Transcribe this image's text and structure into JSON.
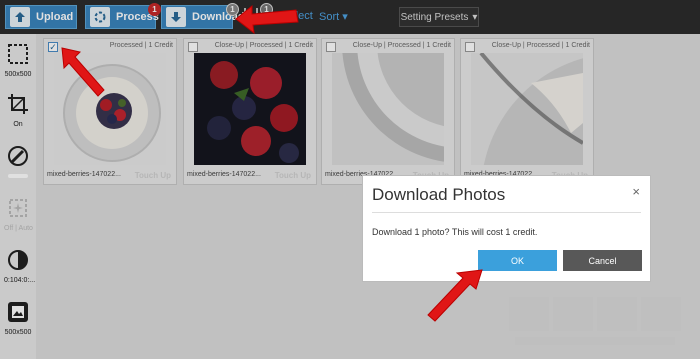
{
  "toolbar": {
    "upload_label": "Upload",
    "process_label": "Process",
    "process_badge": "1",
    "download_label": "Download",
    "download_badge": "1",
    "tray_badge": "1",
    "unselect_label": "Unselect",
    "sort_label": "Sort",
    "presets_label": "Setting Presets",
    "accent": "#3a85bd"
  },
  "sidebar": {
    "tools": [
      {
        "icon": "crop-frame-icon",
        "label": "500x500"
      },
      {
        "icon": "crop-icon",
        "label": "On"
      },
      {
        "icon": "color-tool-icon",
        "label": ""
      },
      {
        "icon": "touch-up-icon",
        "label": "Off | Auto"
      },
      {
        "icon": "contrast-icon",
        "label": "0:104:0:..."
      },
      {
        "icon": "image-size-icon",
        "label": "500x500"
      }
    ]
  },
  "photos": [
    {
      "filename": "mixed-berries-147022...",
      "tag": "",
      "status": "Processed",
      "credit": "1 Credit",
      "action": "Touch Up",
      "checked": true
    },
    {
      "filename": "mixed-berries-147022...",
      "tag": "Close-Up",
      "status": "Processed",
      "credit": "1 Credit",
      "action": "Touch Up",
      "checked": false
    },
    {
      "filename": "mixed-berries-147022...",
      "tag": "Close-Up",
      "status": "Processed",
      "credit": "1 Credit",
      "action": "Touch Up",
      "checked": false
    },
    {
      "filename": "mixed-berries-147022...",
      "tag": "Close-Up",
      "status": "Processed",
      "credit": "1 Credit",
      "action": "Touch Up",
      "checked": false
    }
  ],
  "dialog": {
    "title": "Download Photos",
    "close": "×",
    "message": "Download 1 photo? This will cost 1 credit.",
    "ok_label": "OK",
    "cancel_label": "Cancel",
    "ok_color": "#3ba0dc",
    "cancel_color": "#585858"
  }
}
